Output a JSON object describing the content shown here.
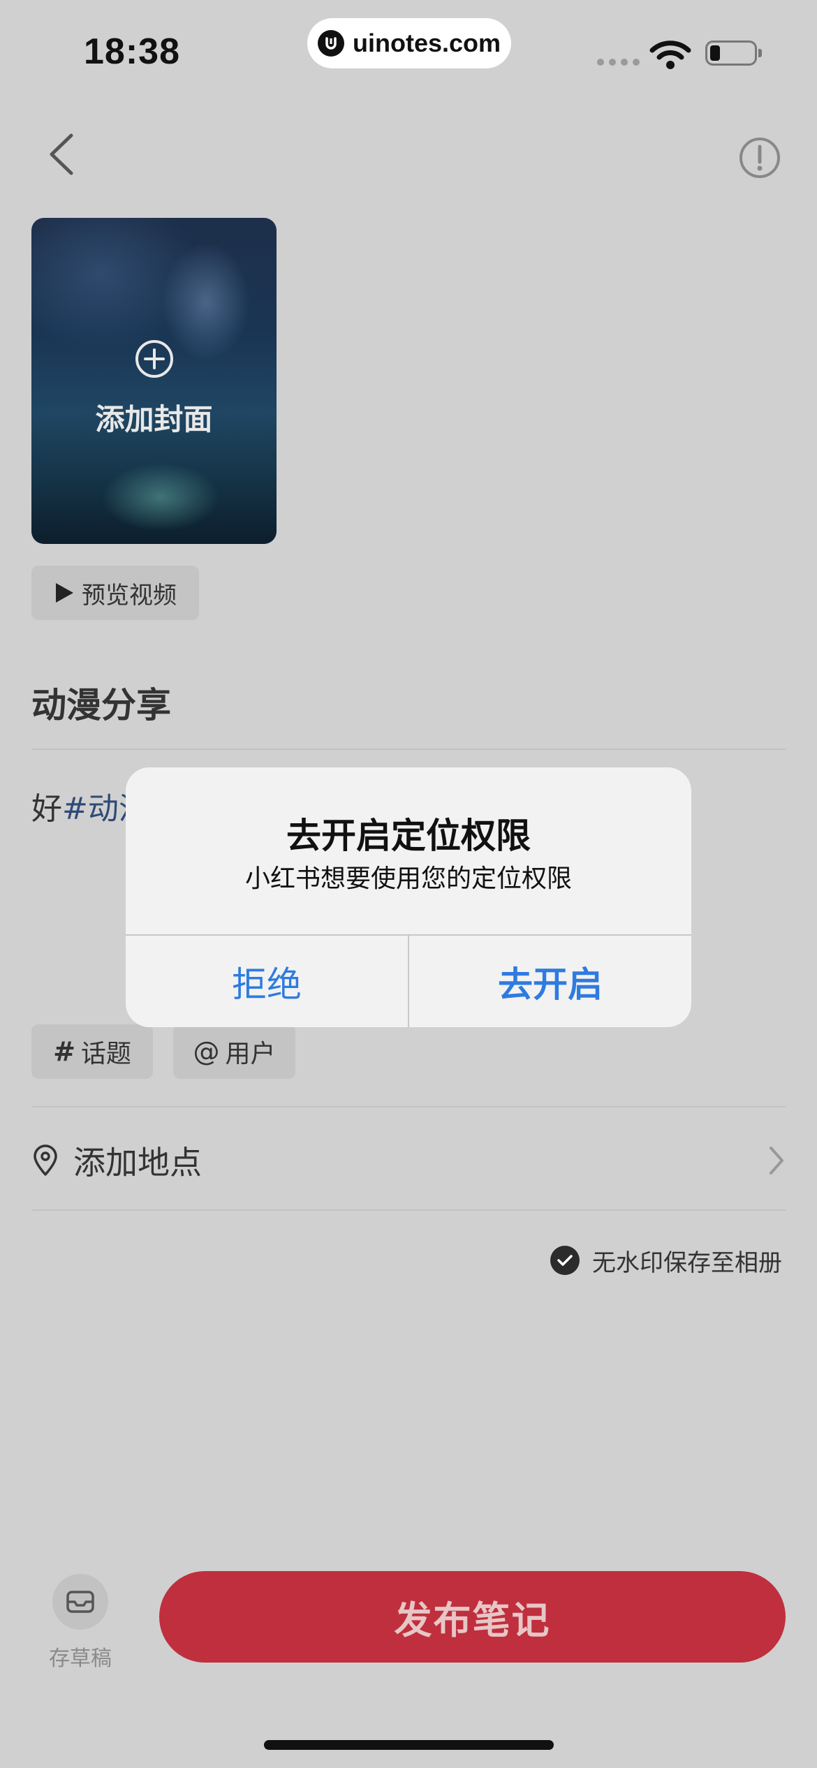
{
  "status_bar": {
    "time": "18:38",
    "watermark": "uinotes.com"
  },
  "cover": {
    "add_label": "添加封面"
  },
  "preview": {
    "label": "预览视频"
  },
  "note": {
    "title": "动漫分享",
    "body_prefix": "好",
    "body_tag": "#动漫"
  },
  "chips": {
    "topic_symbol": "#",
    "topic_label": "话题",
    "user_symbol": "@",
    "user_label": "用户"
  },
  "location": {
    "label": "添加地点"
  },
  "save_option": {
    "label": "无水印保存至相册"
  },
  "bottom": {
    "draft_label": "存草稿",
    "publish_label": "发布笔记"
  },
  "alert": {
    "title": "去开启定位权限",
    "message": "小红书想要使用您的定位权限",
    "deny_label": "拒绝",
    "allow_label": "去开启"
  },
  "colors": {
    "accent_blue": "#2e7be0",
    "publish_red": "#bf2f3d",
    "tag_blue": "#2e4a78"
  }
}
